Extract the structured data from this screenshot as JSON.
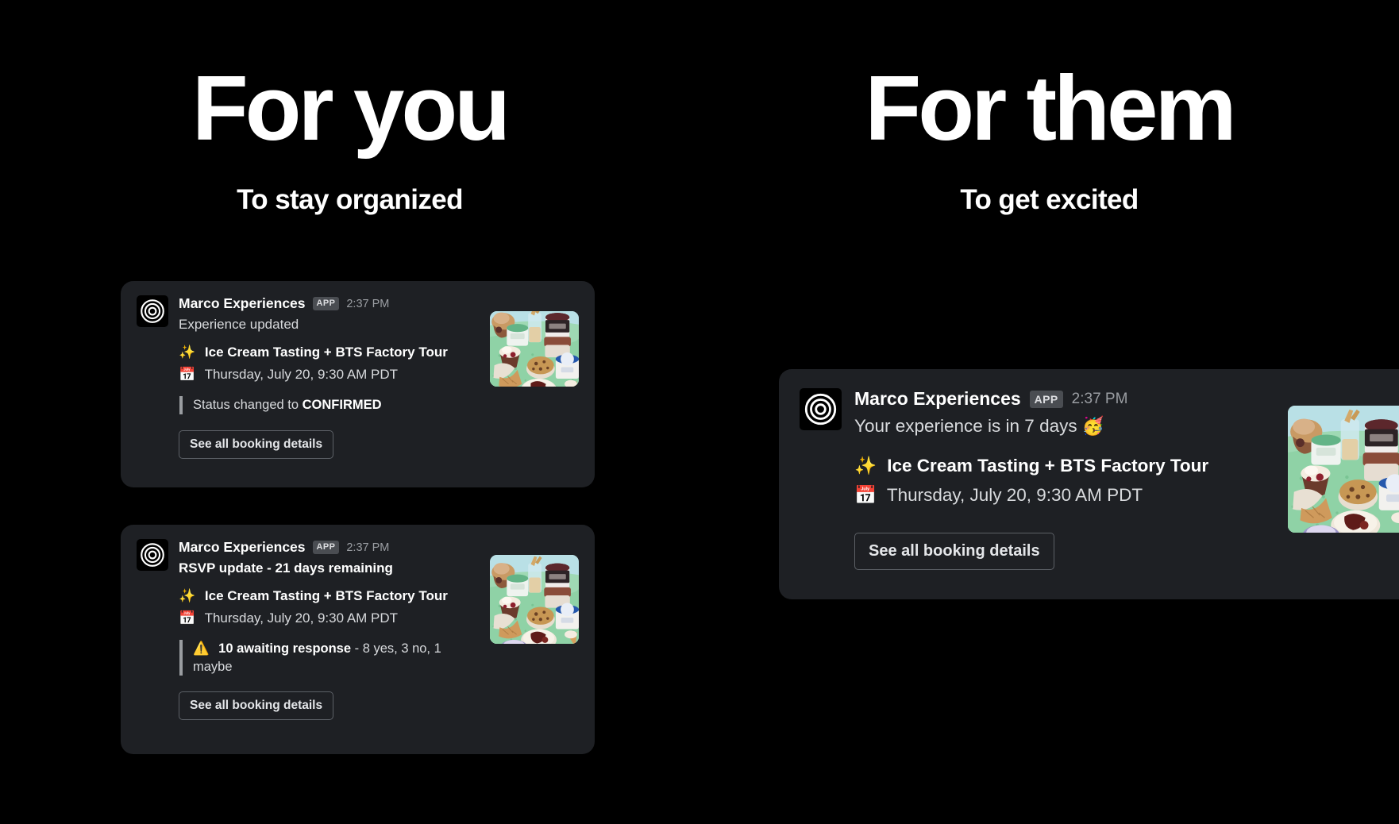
{
  "columns": [
    {
      "headline": "For you",
      "subhead": "To stay organized"
    },
    {
      "headline": "For them",
      "subhead": "To get excited"
    }
  ],
  "app": {
    "name": "Marco Experiences",
    "badge": "APP",
    "avatar_icon": "concentric-circles-target-icon"
  },
  "cards": [
    {
      "id": "card-left-1",
      "timestamp": "2:37 PM",
      "headline": "Experience updated",
      "experience_emoji": "✨",
      "experience_title": "Ice Cream Tasting + BTS Factory Tour",
      "date_emoji": "📅",
      "date_text": "Thursday, July 20, 9:30 AM PDT",
      "quote_prefix": "Status changed to ",
      "quote_strong": "CONFIRMED",
      "quote_suffix": "",
      "button_label": "See all booking details",
      "thumbnail_alt": "ice-cream-desserts-photo"
    },
    {
      "id": "card-left-2",
      "timestamp": "2:37 PM",
      "headline": "RSVP update - 21 days remaining",
      "experience_emoji": "✨",
      "experience_title": "Ice Cream Tasting + BTS Factory Tour",
      "date_emoji": "📅",
      "date_text": "Thursday, July 20, 9:30 AM PDT",
      "quote_emoji": "⚠️",
      "quote_strong": "10 awaiting response",
      "quote_suffix": " - 8 yes, 3 no, 1 maybe",
      "button_label": "See all booking details",
      "thumbnail_alt": "ice-cream-desserts-photo"
    },
    {
      "id": "card-right-1",
      "timestamp": "2:37 PM",
      "headline": "Your experience is in 7 days ",
      "headline_emoji": "🥳",
      "experience_emoji": "✨",
      "experience_title": "Ice Cream Tasting + BTS Factory Tour",
      "date_emoji": "📅",
      "date_text": "Thursday, July 20, 9:30 AM PDT",
      "button_label": "See all booking details",
      "thumbnail_alt": "ice-cream-desserts-photo"
    }
  ],
  "colors": {
    "page_background": "#000000",
    "card_background": "#1e2024",
    "avatar_background": "#000000",
    "badge_background": "#4a4d52",
    "primary_text": "#ffffff",
    "secondary_text": "#d8dadd",
    "muted_text": "#9b9ea3",
    "button_border": "#5c6066",
    "quote_bar": "#9a9da1",
    "thumbnail_background": "#bfe3e8"
  }
}
